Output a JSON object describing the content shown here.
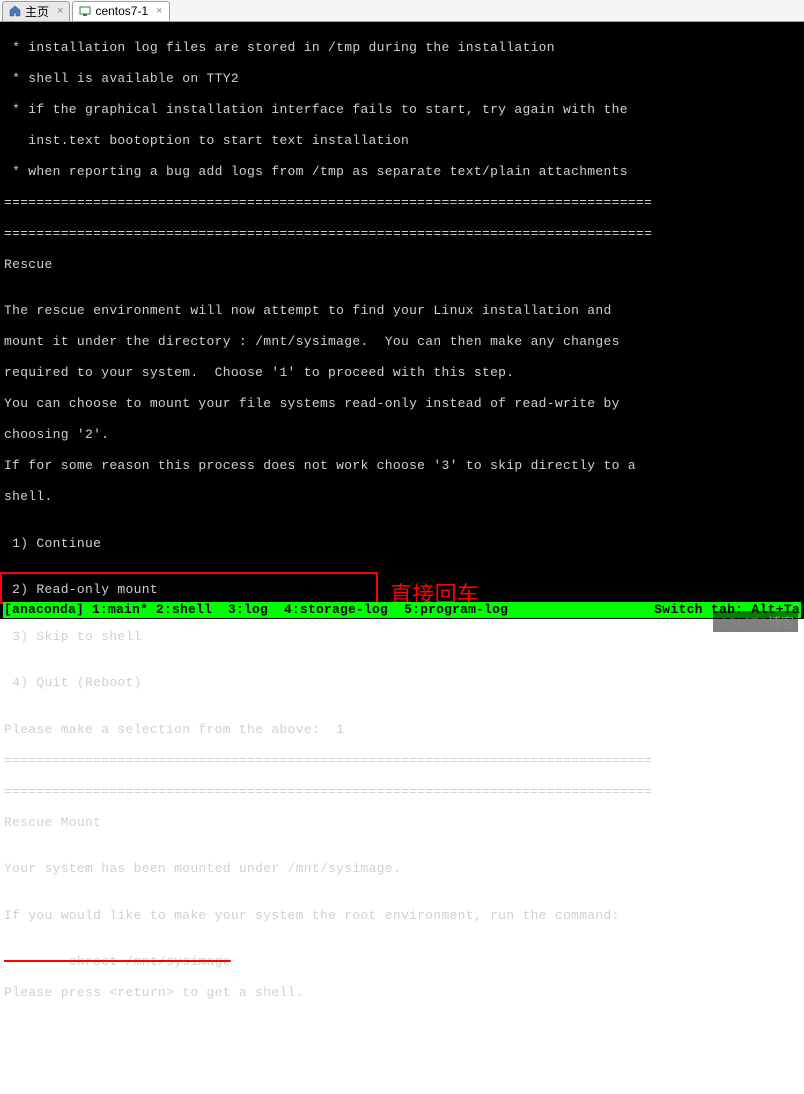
{
  "tabs": {
    "home": {
      "label": "主页"
    },
    "vm": {
      "label": "centos7-1"
    }
  },
  "terminal": {
    "bullet1": " * installation log files are stored in /tmp during the installation",
    "bullet2": " * shell is available on TTY2",
    "bullet3a": " * if the graphical installation interface fails to start, try again with the",
    "bullet3b": "   inst.text bootoption to start text installation",
    "bullet4": " * when reporting a bug add logs from /tmp as separate text/plain attachments",
    "divider1": "================================================================================",
    "divider2": "================================================================================",
    "rescue_title": "Rescue",
    "blank": "",
    "rescue_p1": "The rescue environment will now attempt to find your Linux installation and",
    "rescue_p2": "mount it under the directory : /mnt/sysimage.  You can then make any changes",
    "rescue_p3": "required to your system.  Choose '1' to proceed with this step.",
    "rescue_p4": "You can choose to mount your file systems read-only instead of read-write by",
    "rescue_p5": "choosing '2'.",
    "rescue_p6": "If for some reason this process does not work choose '3' to skip directly to a",
    "rescue_p7": "shell.",
    "opt1": " 1) Continue",
    "opt2": " 2) Read-only mount",
    "opt3": " 3) Skip to shell",
    "opt4": " 4) Quit (Reboot)",
    "prompt": "Please make a selection from the above:  1",
    "divider3": "================================================================================",
    "divider4": "================================================================================",
    "mount_title": "Rescue Mount",
    "mount_p1": "Your system has been mounted under /mnt/sysimage.",
    "mount_p2": "If you would like to make your system the root environment, run the command:",
    "chroot": "        chroot /mnt/sysimage",
    "press_return": "Please press <return> to get a shell."
  },
  "annotation": "直接回车",
  "status": {
    "left": "[anaconda] 1:main* 2:shell  3:log  4:storage-log  5:program-log",
    "right": "Switch tab: Alt+Ta"
  },
  "watermark": "@51CTO博客"
}
